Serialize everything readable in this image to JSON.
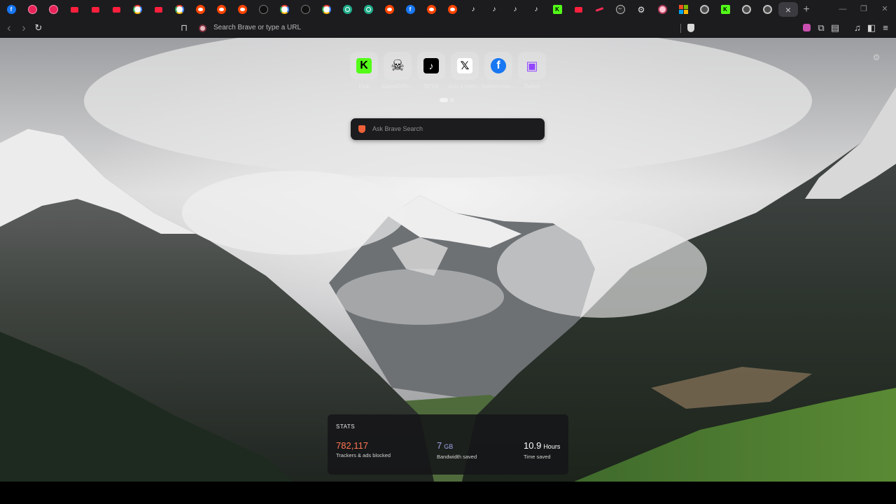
{
  "tabs": {
    "favicons": [
      "facebook",
      "gag",
      "gag",
      "youtube",
      "youtube",
      "youtube",
      "google",
      "youtube",
      "google",
      "reddit",
      "reddit",
      "reddit",
      "darkcirc",
      "google",
      "darkcirc",
      "google",
      "chatgpt",
      "chatgpt",
      "reddit",
      "facebook",
      "reddit",
      "reddit",
      "tiktok",
      "tiktok",
      "tiktok",
      "tiktok",
      "kick",
      "youtube",
      "redline",
      "dots",
      "gear",
      "brave",
      "ms",
      "kook",
      "kick",
      "kook",
      "kook",
      "newtab"
    ],
    "close_glyph": "×",
    "new_tab_glyph": "+",
    "minimize_glyph": "—",
    "restore_glyph": "❐",
    "close_window_glyph": "✕"
  },
  "toolbar": {
    "back_glyph": "‹",
    "forward_glyph": "›",
    "reload_glyph": "↻",
    "bookmark_glyph": "⊓",
    "omnibox_placeholder": "Search Brave or type a URL",
    "right_icons": [
      "rewards-icon",
      "extensions-icon",
      "tab-icon",
      "media-icon",
      "sidebar-icon",
      "menu-icon"
    ]
  },
  "ntp": {
    "top_sites": [
      {
        "name": "Kick",
        "icon": "kick-icon",
        "glyph": "K",
        "color": "#53fc18"
      },
      {
        "name": "GameTrPc...",
        "icon": "skull-icon",
        "glyph": "☠",
        "color": "#000000"
      },
      {
        "name": "TikTok",
        "icon": "tiktok-icon",
        "glyph": "♪",
        "color": "#000000"
      },
      {
        "name": "Just a mom...",
        "icon": "x-icon",
        "glyph": "𝕏",
        "color": "#000000"
      },
      {
        "name": "todoro mes...",
        "icon": "facebook-icon",
        "glyph": "f",
        "color": "#1877f2"
      },
      {
        "name": "Twitch",
        "icon": "twitch-icon",
        "glyph": "▣",
        "color": "#9146ff"
      }
    ],
    "search_placeholder": "Ask Brave Search",
    "stats": {
      "title": "STATS",
      "trackers_value": "782,117",
      "trackers_label": "Trackers & ads blocked",
      "bandwidth_value": "7",
      "bandwidth_unit": "GB",
      "bandwidth_label": "Bandwidth saved",
      "time_value": "10.9",
      "time_unit": "Hours",
      "time_label": "Time saved"
    },
    "colors": {
      "trackers": "#ff7654",
      "bandwidth": "#a0a5eb",
      "time": "#ffffff"
    }
  }
}
